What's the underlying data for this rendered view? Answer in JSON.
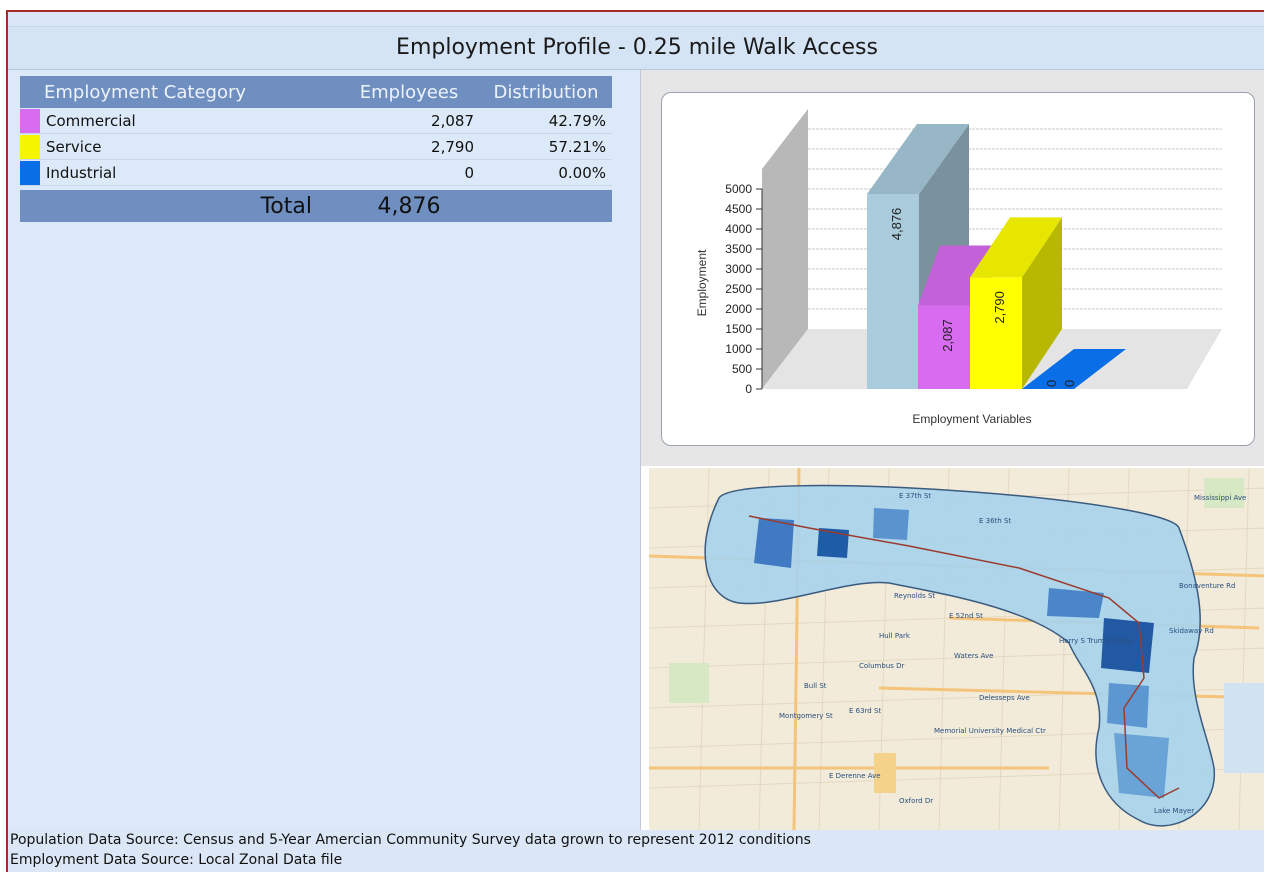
{
  "title": "Employment Profile - 0.25 mile Walk Access",
  "table": {
    "headers": [
      "Employment Category",
      "Employees",
      "Distribution"
    ],
    "rows": [
      {
        "category": "Commercial",
        "employees": "2,087",
        "distribution": "42.79%",
        "color": "#d86cf0"
      },
      {
        "category": "Service",
        "employees": "2,790",
        "distribution": "57.21%",
        "color": "#f5f500"
      },
      {
        "category": "Industrial",
        "employees": "0",
        "distribution": "0.00%",
        "color": "#0a6ee6"
      }
    ],
    "total_label": "Total",
    "total_value": "4,876"
  },
  "chart_data": {
    "type": "bar",
    "categories": [
      "Total",
      "Commercial",
      "Service",
      "Industrial"
    ],
    "values": [
      4876,
      2087,
      2790,
      0
    ],
    "data_labels": [
      "4,876",
      "2,087",
      "2,790",
      "0",
      "0"
    ],
    "colors": [
      "#a9cbdc",
      "#d86cf0",
      "#ffff00",
      "#0a6ee6"
    ],
    "xlabel": "Employment Variables",
    "ylabel": "Employment",
    "yticks": [
      0,
      500,
      1000,
      1500,
      2000,
      2500,
      3000,
      3500,
      4000,
      4500,
      5000
    ],
    "ylim": [
      0,
      5000
    ],
    "grid": true
  },
  "map": {
    "street_labels": [
      "E 37th St",
      "E 36th St",
      "Bonaventure Rd",
      "Mississippi Ave",
      "Columbus Dr",
      "Delesseps Ave",
      "E Derenne Ave",
      "Oxford Dr",
      "Harry S Truman Pkwy",
      "Hull Park",
      "Skidaway Rd",
      "Waters Ave",
      "Bull St",
      "Montgomery St",
      "Reynolds St",
      "E 52nd St",
      "E 63rd St",
      "Memorial University Medical Ctr",
      "Lake Mayer"
    ]
  },
  "footer": {
    "line1": "Population Data Source: Census and 5-Year Amercian Community Survey data grown to represent 2012 conditions",
    "line2": "Employment Data Source: Local Zonal Data file"
  }
}
